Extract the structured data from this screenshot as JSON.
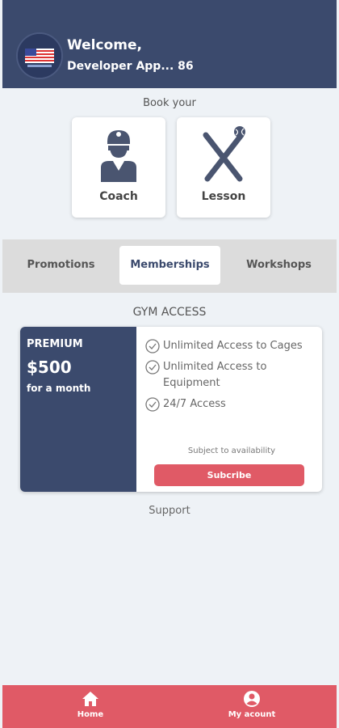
{
  "header": {
    "welcome": "Welcome,",
    "username": "Developer App... 86"
  },
  "book": {
    "title": "Book your",
    "cards": [
      {
        "label": "Coach",
        "icon": "coach-icon"
      },
      {
        "label": "Lesson",
        "icon": "baseball-bats-icon"
      }
    ]
  },
  "tabs": [
    {
      "label": "Promotions",
      "active": false
    },
    {
      "label": "Memberships",
      "active": true
    },
    {
      "label": "Workshops",
      "active": false
    }
  ],
  "gym": {
    "section_title": "GYM ACCESS",
    "plan": {
      "name": "PREMIUM",
      "price": "$500",
      "period": "for a month",
      "features": [
        "Unlimited Access to Cages",
        "Unlimited Access to Equipment",
        "24/7 Access"
      ],
      "availability": "Subject to availability",
      "subscribe_label": "Subcribe"
    }
  },
  "support": "Support",
  "nav": {
    "home": "Home",
    "account": "My acount"
  },
  "colors": {
    "header": "#3b4a6d",
    "accent": "#e05a66",
    "background": "#eef2f6"
  }
}
